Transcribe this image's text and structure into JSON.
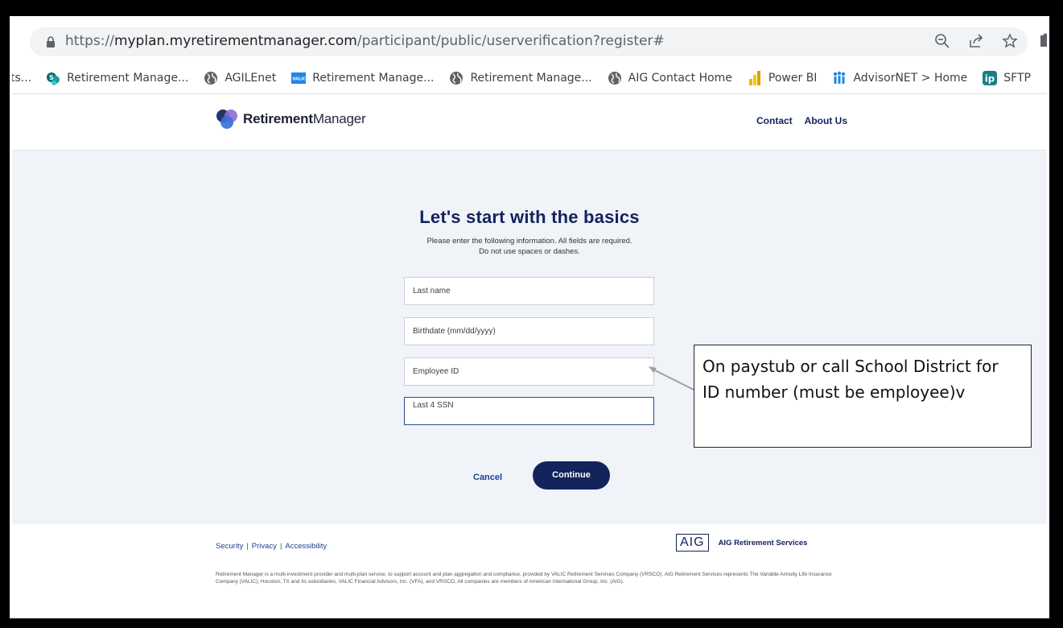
{
  "browser": {
    "url_scheme": "https://",
    "url_host": "myplan.myretirementmanager.com",
    "url_path": "/participant/public/userverification?register#",
    "bookmarks_cut": "ts...",
    "bookmarks": [
      {
        "label": "Retirement Manage...",
        "icon": "sharepoint-icon"
      },
      {
        "label": "AGILEnet",
        "icon": "globe-icon"
      },
      {
        "label": "Retirement Manage...",
        "icon": "valic-icon"
      },
      {
        "label": "Retirement Manage...",
        "icon": "globe-icon"
      },
      {
        "label": "AIG Contact Home",
        "icon": "globe-icon"
      },
      {
        "label": "Power BI",
        "icon": "powerbi-icon"
      },
      {
        "label": "AdvisorNET > Home",
        "icon": "advisornet-icon"
      },
      {
        "label": "SFTP",
        "icon": "ip-icon"
      }
    ],
    "valic_badge": "VALIC",
    "ip_badge": "ip"
  },
  "header": {
    "logo_bold": "Retirement",
    "logo_regular": "Manager",
    "nav": [
      "Contact",
      "About Us"
    ]
  },
  "form": {
    "heading": "Let's start with the basics",
    "instruction_line1": "Please enter the following information. All fields are required.",
    "instruction_line2": "Do not use spaces or dashes.",
    "fields": [
      {
        "placeholder": "Last name"
      },
      {
        "placeholder": "Birthdate (mm/dd/yyyy)"
      },
      {
        "placeholder": "Employee ID"
      },
      {
        "placeholder": "Last 4 SSN"
      }
    ],
    "cancel_label": "Cancel",
    "continue_label": "Continue"
  },
  "callout": {
    "text": "On paystub or call School District for ID number (must be employee)v"
  },
  "footer": {
    "links": [
      "Security",
      "Privacy",
      "Accessibility"
    ],
    "aig_logo": "AIG",
    "aig_name": "AIG Retirement Services",
    "disclaimer": "Retirement Manager is a multi-investment provider and multi-plan service, to support account and plan aggregation and compliance, provided by VALIC Retirement Services Company (VRSCO). AIG Retirement Services represents The Variable Annuity Life Insurance Company (VALIC), Houston, TX and its subsidiaries, VALIC Financial Advisors, Inc. (VFA), and VRSCO. All companies are members of American International Group, Inc. (AIG)."
  },
  "colors": {
    "brand_navy": "#13235b",
    "page_bg": "#f0f3f8",
    "link_blue": "#1f3f8f"
  }
}
